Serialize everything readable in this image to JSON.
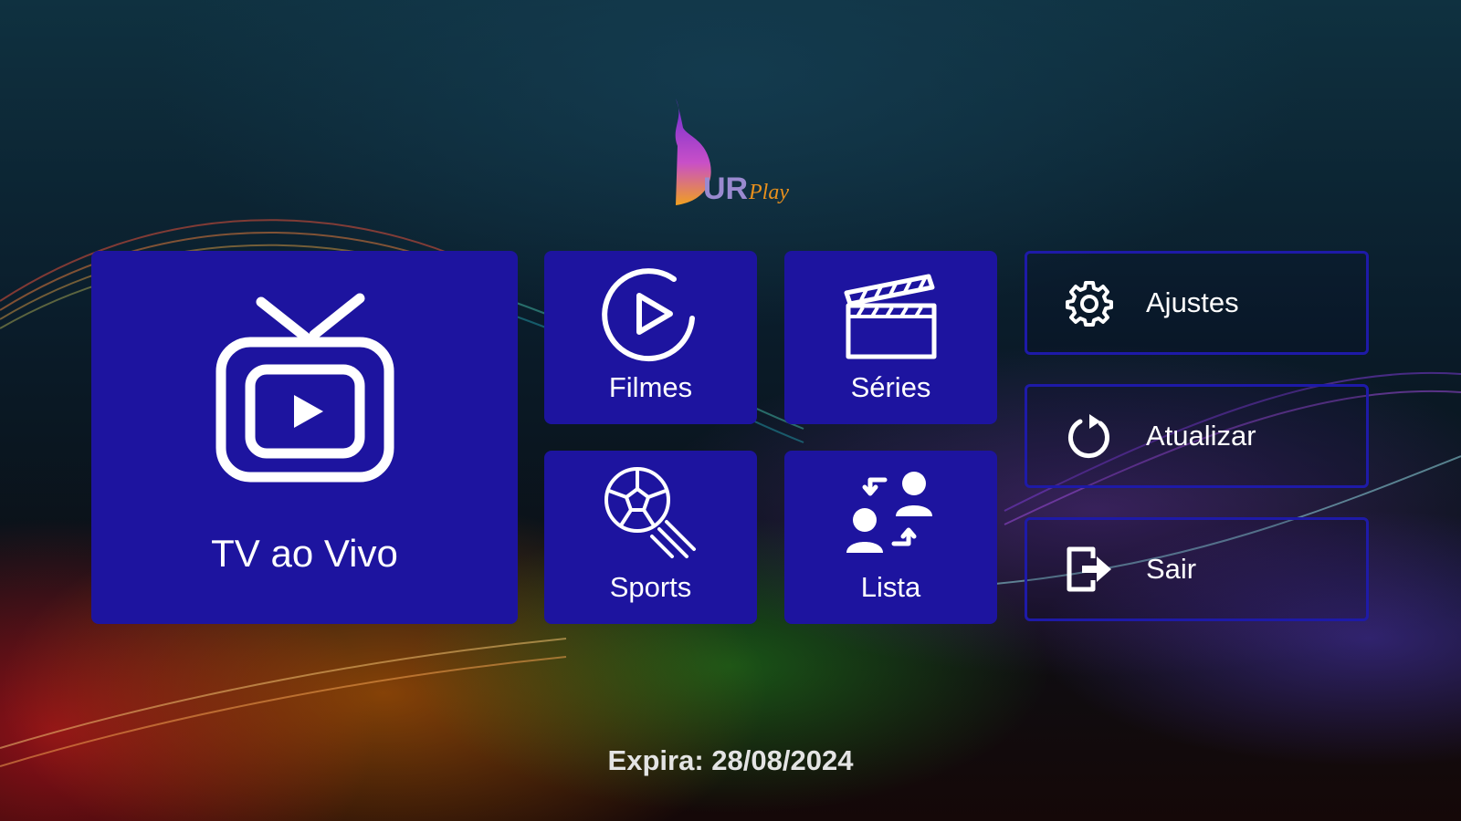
{
  "app": {
    "logo_text": "VIR Play"
  },
  "tiles": {
    "live_tv": {
      "label": "TV ao Vivo",
      "icon": "tv-play-icon"
    },
    "movies": {
      "label": "Filmes",
      "icon": "play-circle-icon"
    },
    "series": {
      "label": "Séries",
      "icon": "clapperboard-icon"
    },
    "sports": {
      "label": "Sports",
      "icon": "soccer-ball-icon"
    },
    "list": {
      "label": "Lista",
      "icon": "switch-users-icon"
    }
  },
  "side_menu": {
    "settings": {
      "label": "Ajustes",
      "icon": "gear-icon"
    },
    "refresh": {
      "label": "Atualizar",
      "icon": "refresh-icon"
    },
    "exit": {
      "label": "Sair",
      "icon": "logout-icon"
    }
  },
  "footer": {
    "expiry_label": "Expira:",
    "expiry_date": "28/08/2024"
  },
  "colors": {
    "tile": "#1d149f",
    "side_border": "#1e1aa8",
    "text": "#ffffff"
  }
}
